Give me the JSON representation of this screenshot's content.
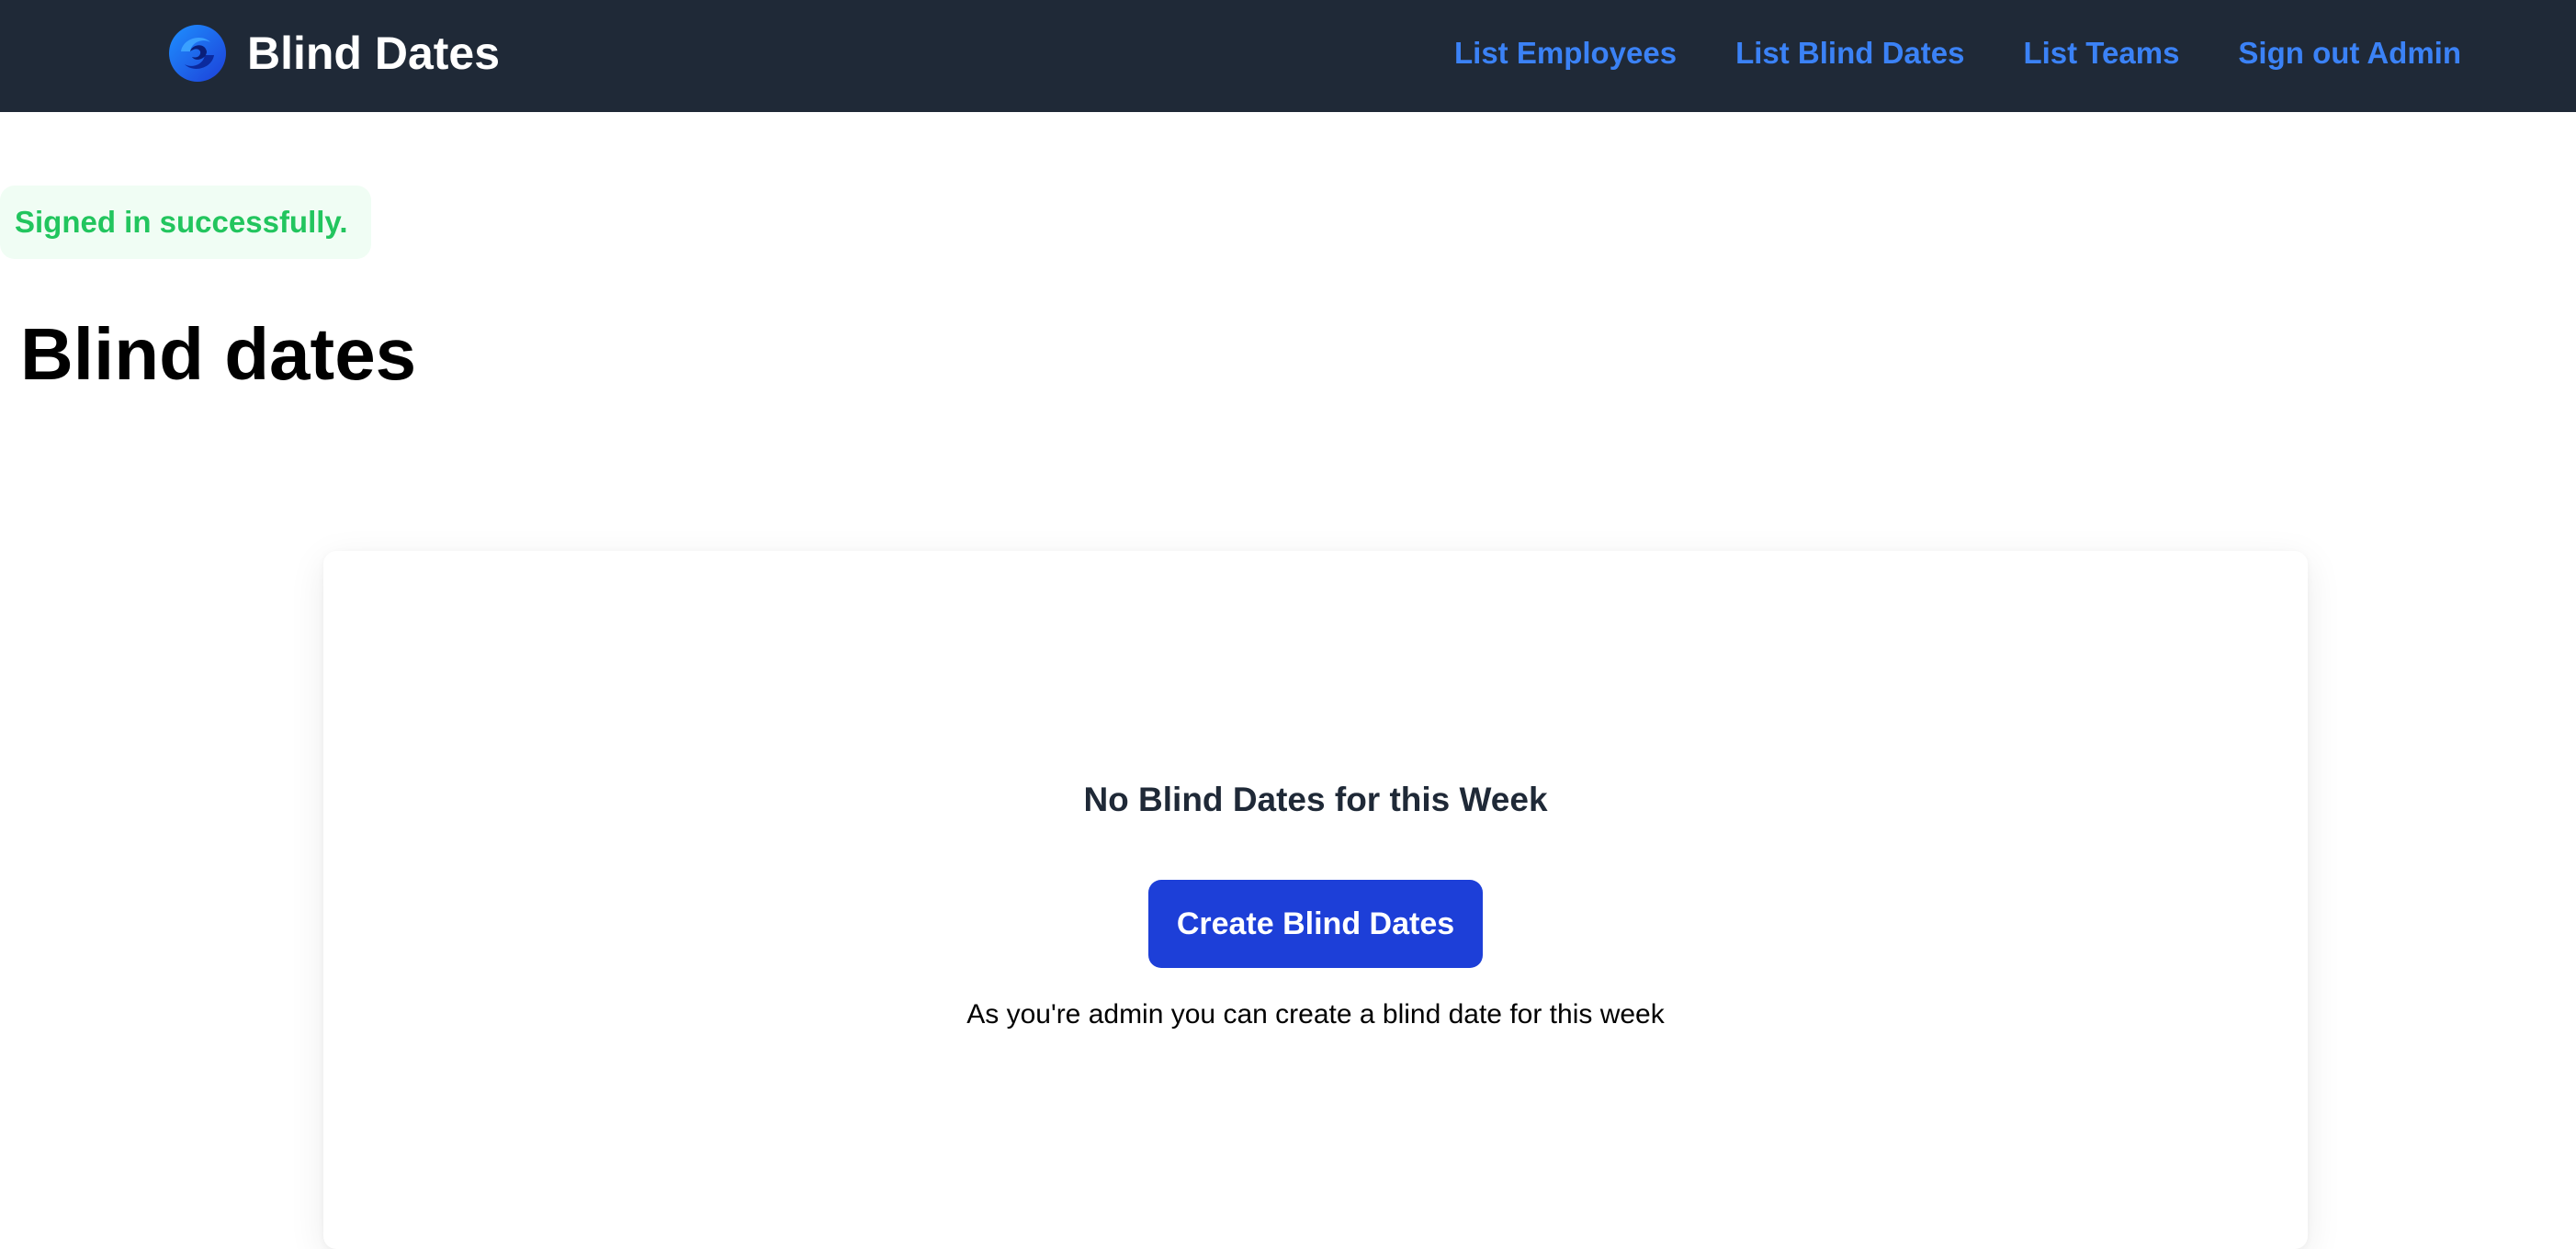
{
  "navbar": {
    "brand_name": "Blind Dates",
    "logo_icon": "swirl-logo-icon",
    "links": [
      "List Employees",
      "List Blind Dates",
      "List Teams",
      "Sign out Admin"
    ]
  },
  "flash": {
    "message": "Signed in successfully."
  },
  "page": {
    "title": "Blind dates"
  },
  "empty_state": {
    "heading": "No Blind Dates for this Week",
    "button_label": "Create Blind Dates",
    "note": "As you're admin you can create a blind date for this week"
  },
  "colors": {
    "navbar_bg": "#1f2937",
    "link": "#3b82f6",
    "flash_text": "#22c55e",
    "flash_bg": "#f0fdf4",
    "button_bg": "#1d3fd8"
  }
}
